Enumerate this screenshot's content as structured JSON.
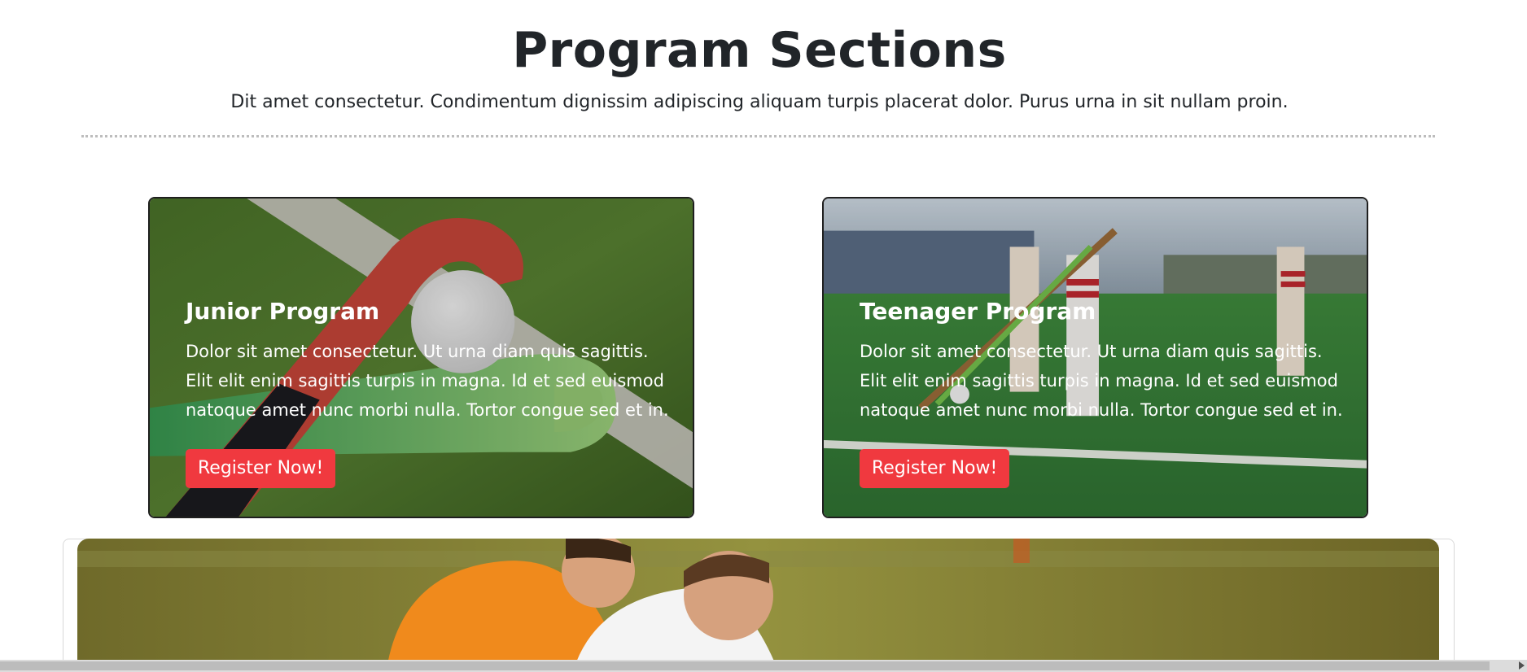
{
  "header": {
    "title": "Program Sections",
    "subtitle": "Dit amet consectetur. Condimentum dignissim adipiscing aliquam turpis placerat dolor. Purus urna in sit nullam proin."
  },
  "programs": [
    {
      "title": "Junior Program",
      "text": "Dolor sit amet consectetur. Ut urna diam quis sagittis. Elit elit enim sagittis turpis in magna. Id et sed euismod natoque amet nunc morbi nulla. Tortor congue sed et in.",
      "button": "Register Now!"
    },
    {
      "title": "Teenager Program",
      "text": "Dolor sit amet consectetur. Ut urna diam quis sagittis. Elit elit enim sagittis turpis in magna. Id et sed euismod natoque amet nunc morbi nulla. Tortor congue sed et in.",
      "button": "Register Now!"
    }
  ],
  "colors": {
    "accent": "#f0393f",
    "text": "#212529",
    "divider": "#bdbdbd"
  },
  "icons": {
    "scroll_right": "chevron-right-icon"
  }
}
